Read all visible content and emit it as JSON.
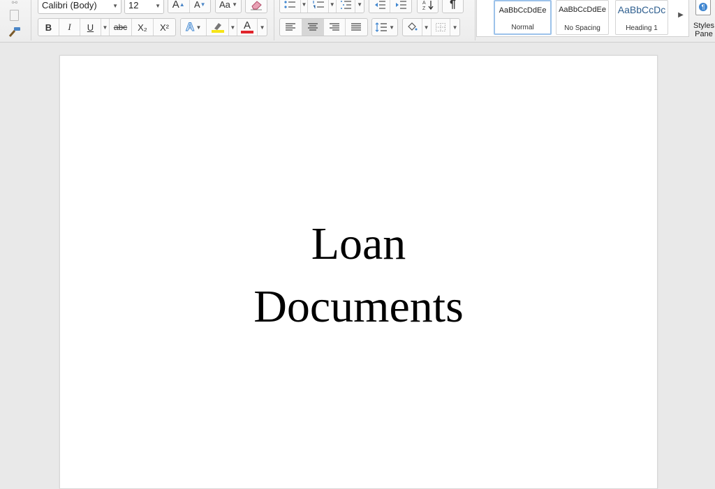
{
  "font": {
    "name": "Calibri (Body)",
    "size": "12"
  },
  "format_buttons": {
    "bold": "B",
    "italic": "I",
    "underline": "U",
    "strikethrough": "abc",
    "subscript": "X₂",
    "superscript": "X²",
    "text_effects": "A",
    "font_color": "A",
    "grow": "A",
    "shrink": "A",
    "change_case": "Aa"
  },
  "styles": [
    {
      "preview": "AaBbCcDdEe",
      "name": "Normal"
    },
    {
      "preview": "AaBbCcDdEe",
      "name": "No Spacing"
    },
    {
      "preview": "AaBbCcDc",
      "name": "Heading 1"
    }
  ],
  "styles_pane": "Styles Pane",
  "colors": {
    "highlight": "#f6e417",
    "font_color": "#e0242b",
    "heading_preview": "#2f5f8f",
    "selected_style_border": "#9cc2ea"
  },
  "document": {
    "line1": "Loan",
    "line2": "Documents"
  }
}
